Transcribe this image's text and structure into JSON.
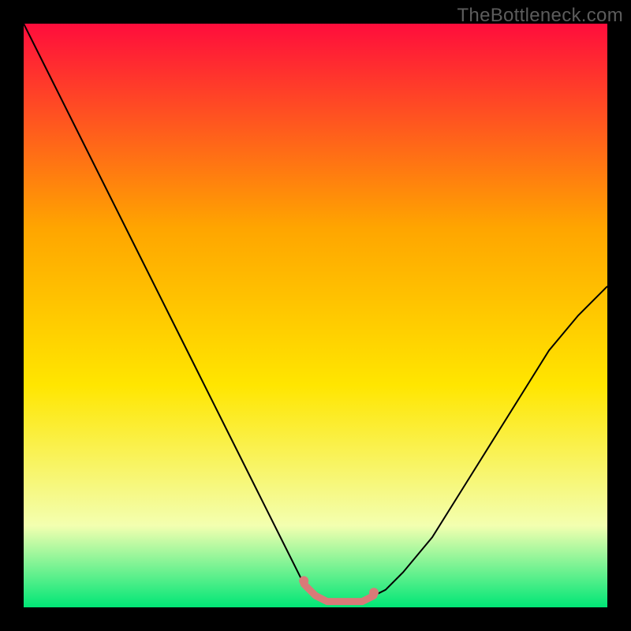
{
  "watermark": "TheBottleneck.com",
  "chart_data": {
    "type": "line",
    "title": "",
    "xlabel": "",
    "ylabel": "",
    "xlim": [
      0,
      100
    ],
    "ylim": [
      0,
      100
    ],
    "background_gradient": {
      "top": "#ff0d3c",
      "upper_mid": "#ffa500",
      "mid": "#ffe600",
      "lower_mid": "#f3ffb0",
      "bottom": "#00e676"
    },
    "series": [
      {
        "name": "bottleneck-curve",
        "color": "#000000",
        "x": [
          0,
          5,
          10,
          15,
          20,
          25,
          30,
          35,
          40,
          45,
          48,
          50,
          52,
          54,
          56,
          58,
          60,
          62,
          65,
          70,
          75,
          80,
          85,
          90,
          95,
          100
        ],
        "y": [
          100,
          90,
          80,
          70,
          60,
          50,
          40,
          30,
          20,
          10,
          4,
          2,
          1,
          1,
          1,
          1,
          2,
          3,
          6,
          12,
          20,
          28,
          36,
          44,
          50,
          55
        ]
      },
      {
        "name": "optimal-zone-highlight",
        "color": "#d97a78",
        "x": [
          48,
          50,
          52,
          54,
          56,
          58,
          60
        ],
        "y": [
          4,
          2,
          1,
          1,
          1,
          1,
          2
        ]
      }
    ],
    "optimal_zone": {
      "x_start": 48,
      "x_end": 60
    }
  }
}
